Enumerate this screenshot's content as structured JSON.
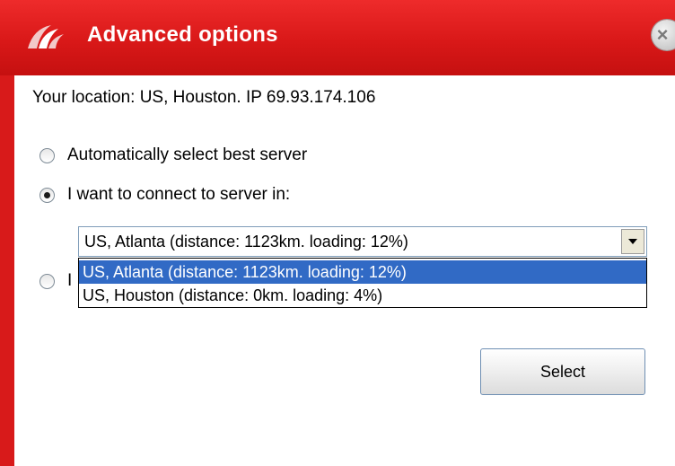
{
  "window": {
    "title": "Advanced options",
    "colors": {
      "titlebar": "#d91818",
      "selection": "#316ac5"
    }
  },
  "location": {
    "text": "Your location: US, Houston.  IP 69.93.174.106"
  },
  "options": {
    "auto_label": "Automatically select best server",
    "manual_label": "I want to connect to server in:",
    "third_label": "I",
    "selected": "manual"
  },
  "server_select": {
    "value": "US, Atlanta (distance: 1123km. loading: 12%)",
    "options": [
      "US, Atlanta (distance: 1123km. loading: 12%)",
      "US, Houston (distance: 0km. loading: 4%)"
    ]
  },
  "buttons": {
    "select_label": "Select"
  }
}
